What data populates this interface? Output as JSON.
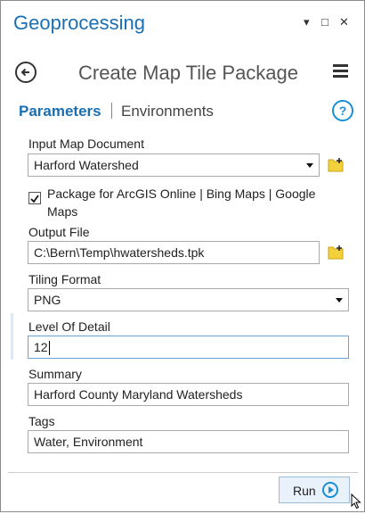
{
  "pane": {
    "title": "Geoprocessing"
  },
  "header": {
    "tool_title": "Create Map Tile Package"
  },
  "tabs": {
    "parameters": "Parameters",
    "environments": "Environments"
  },
  "fields": {
    "input_map": {
      "label": "Input Map Document",
      "value": "Harford Watershed"
    },
    "package_option": {
      "label": "Package for ArcGIS Online | Bing Maps | Google Maps",
      "checked": true
    },
    "output_file": {
      "label": "Output File",
      "value": "C:\\Bern\\Temp\\hwatersheds.tpk"
    },
    "tiling_format": {
      "label": "Tiling Format",
      "value": "PNG"
    },
    "level_of_detail": {
      "label": "Level Of Detail",
      "value": "12"
    },
    "summary": {
      "label": "Summary",
      "value": "Harford County Maryland Watersheds"
    },
    "tags": {
      "label": "Tags",
      "value": "Water, Environment"
    }
  },
  "footer": {
    "run_label": "Run"
  },
  "colors": {
    "accent": "#1a6fb3",
    "help": "#1a8fd8",
    "folder": "#f2d13a"
  }
}
